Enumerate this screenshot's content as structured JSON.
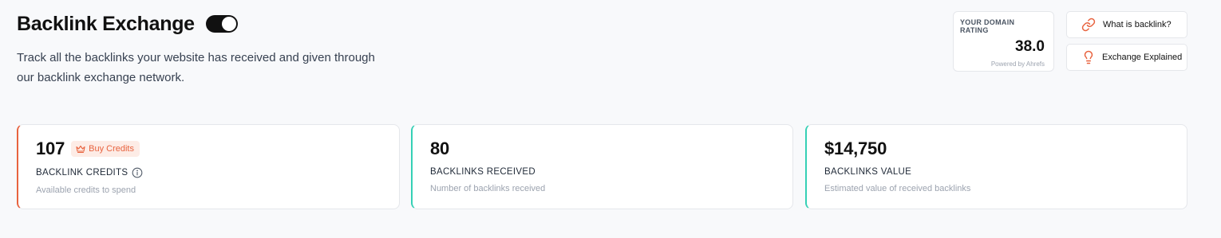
{
  "header": {
    "title": "Backlink Exchange",
    "toggle_on": true,
    "subtitle_line1": "Track all the backlinks your website has received and given through",
    "subtitle_line2": "our backlink exchange network."
  },
  "domain_rating": {
    "label": "YOUR DOMAIN RATING",
    "value": "38.0",
    "powered_by": "Powered by Ahrefs"
  },
  "buttons": {
    "what_is_backlink": {
      "label": "What is backlink?",
      "icon": "link-icon"
    },
    "exchange_explained": {
      "label": "Exchange Explained",
      "icon": "lightbulb-icon"
    }
  },
  "stats": [
    {
      "value": "107",
      "label": "BACKLINK CREDITS",
      "description": "Available credits to spend",
      "badge_label": "Buy Credits",
      "badge_icon": "crown-icon",
      "accent_color": "#e8633f"
    },
    {
      "value": "80",
      "label": "BACKLINKS RECEIVED",
      "description": "Number of backlinks received",
      "accent_color": "#35d0b5"
    },
    {
      "value": "$14,750",
      "label": "BACKLINKS VALUE",
      "description": "Estimated value of received backlinks",
      "accent_color": "#35d0b5"
    }
  ],
  "colors": {
    "accent_orange": "#e8633f",
    "accent_teal": "#35d0b5",
    "background": "#f8f9fb"
  }
}
